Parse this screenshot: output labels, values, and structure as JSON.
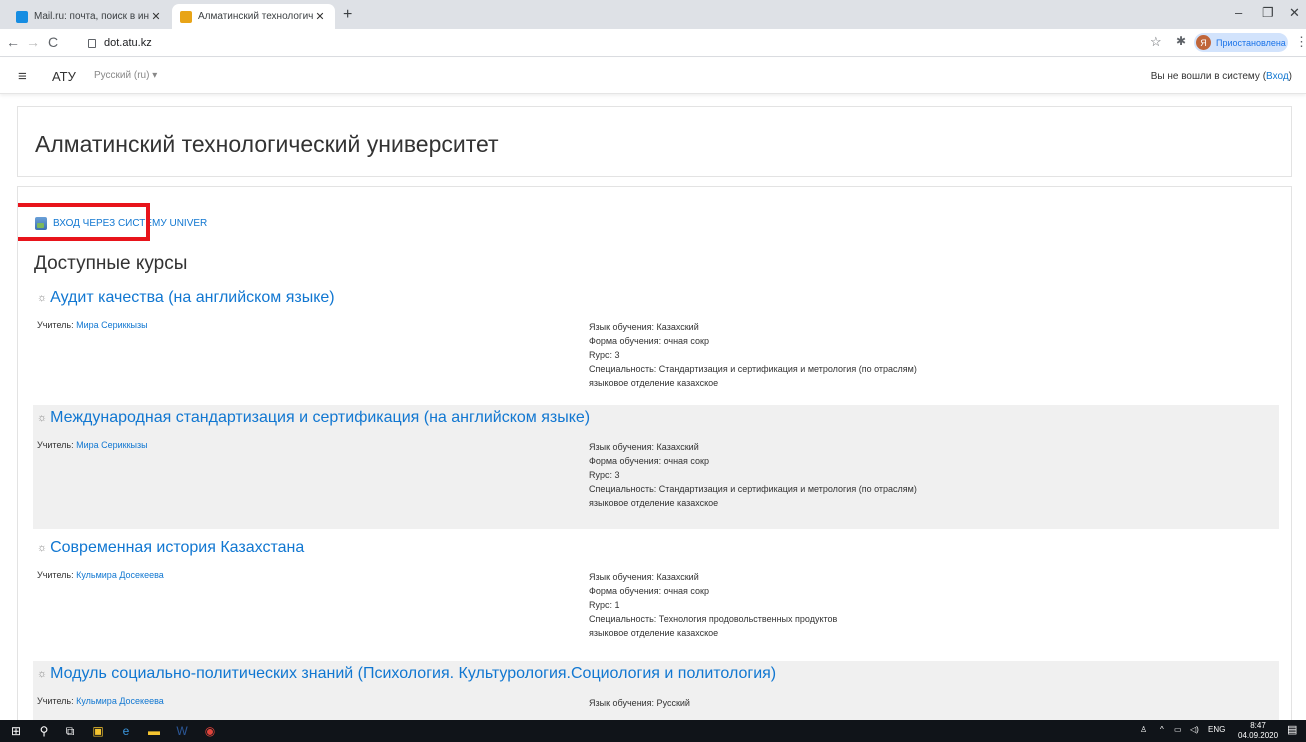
{
  "browser": {
    "tabs": [
      {
        "title": "Mail.ru: почта, поиск в интерне",
        "active": false
      },
      {
        "title": "Алматинский технологический",
        "active": true
      }
    ],
    "url": "dot.atu.kz",
    "profile_label": "Приостановлена",
    "profile_initial": "Я"
  },
  "navbar": {
    "brand": "АТУ",
    "language": "Русский (ru) ▾",
    "login_text": "Вы не вошли в систему (",
    "login_link": "Вход",
    "login_close": ")"
  },
  "page": {
    "title": "Алматинский технологический университет",
    "univer_link": "ВХОД ЧЕРЕЗ СИСТЕМУ UNIVER",
    "available_heading": "Доступные курсы"
  },
  "courses": [
    {
      "name": "Аудит качества (на английском языке)",
      "teacher_label": "Учитель: ",
      "teacher": "Мира Сериккызы",
      "info": [
        "Язык обучения: Казахский",
        "Форма обучения: очная сокр",
        "Rypc: 3",
        "Специальность: Стандартизация и сертификация и метрология (по отраслям)",
        "языковое отделение казахское"
      ]
    },
    {
      "name": "Международная стандартизация и сертификация (на английском языке)",
      "teacher_label": "Учитель: ",
      "teacher": "Мира Сериккызы",
      "info": [
        "Язык обучения: Казахский",
        "Форма обучения: очная сокр",
        "Rypc: 3",
        "Специальность: Стандартизация и сертификация и метрология (по отраслям)",
        "языковое отделение казахское"
      ]
    },
    {
      "name": "Современная история Казахстана",
      "teacher_label": "Учитель: ",
      "teacher": "Кульмира Досекеева",
      "info": [
        "Язык обучения: Казахский",
        "Форма обучения: очная сокр",
        "Rypc: 1",
        "Специальность: Технология продовольственных продуктов",
        "языковое отделение казахское"
      ]
    },
    {
      "name": "Модуль социально-политических знаний (Психология. Культурология.Социология и политология)",
      "teacher_label": "Учитель: ",
      "teacher": "Кульмира Досекеева",
      "info": [
        "Язык обучения: Русский"
      ]
    }
  ],
  "taskbar": {
    "lang": "ENG",
    "time": "8:47",
    "date": "04.09.2020"
  },
  "colors": {
    "link": "#1177d1",
    "highlight_box": "#e8141b",
    "shaded_row": "#f0f0f0"
  }
}
